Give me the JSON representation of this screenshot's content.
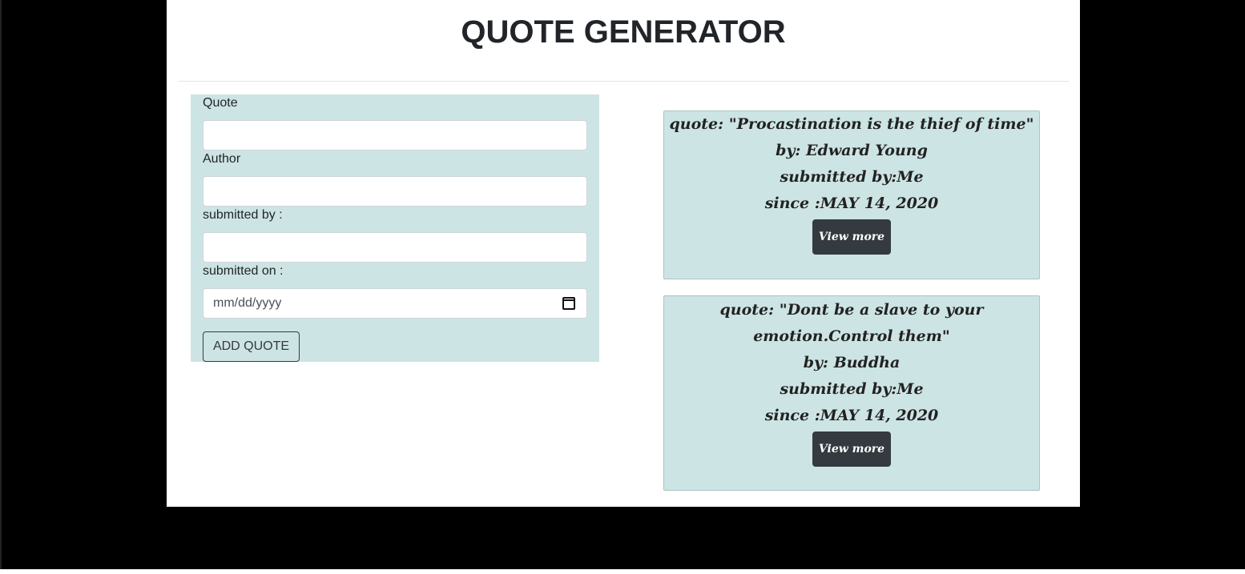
{
  "header": {
    "title": "QUOTE GENERATOR"
  },
  "form": {
    "quote_label": "Quote",
    "quote_value": "",
    "author_label": "Author",
    "author_value": "",
    "submitted_by_label": "submitted by :",
    "submitted_by_value": "",
    "submitted_on_label": "submitted on :",
    "submitted_on_placeholder": "mm/dd/yyyy",
    "add_button_label": "ADD QUOTE"
  },
  "quotes": [
    {
      "quote_lines": [
        "quote: \"Procastination is the thief of time\""
      ],
      "author": "by: Edward Young",
      "submitted_by": "submitted by:Me",
      "since": "since :MAY 14, 2020",
      "button_label": "View more"
    },
    {
      "quote_lines": [
        "quote: \"Dont be a slave to your",
        "emotion.Control them\""
      ],
      "author": "by: Buddha",
      "submitted_by": "submitted by:Me",
      "since": "since :MAY 14, 2020",
      "button_label": "View more"
    }
  ]
}
